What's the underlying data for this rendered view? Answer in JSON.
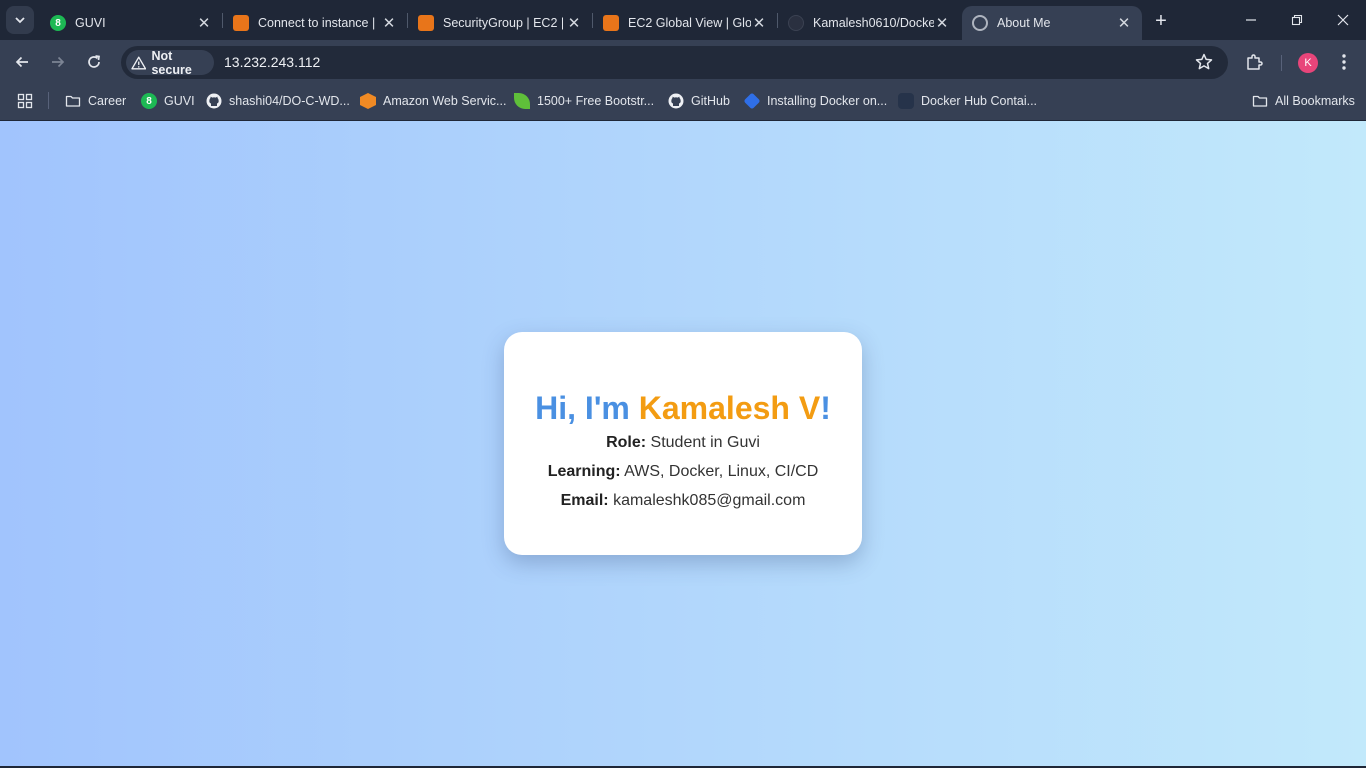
{
  "tabs": [
    {
      "title": "GUVI",
      "favicon": "guvi-icon"
    },
    {
      "title": "Connect to instance |",
      "favicon": "aws-ec2-icon"
    },
    {
      "title": "SecurityGroup | EC2 |",
      "favicon": "aws-ec2-icon"
    },
    {
      "title": "EC2 Global View | Glo",
      "favicon": "aws-ec2-icon"
    },
    {
      "title": "Kamalesh0610/Docke",
      "favicon": "github-icon"
    },
    {
      "title": "About Me",
      "favicon": "globe-icon",
      "active": true
    }
  ],
  "toolbar": {
    "security_label": "Not secure",
    "url": "13.232.243.112",
    "profile_initial": "K"
  },
  "bookmarks": [
    {
      "label": "Career",
      "icon": "folder-icon"
    },
    {
      "label": "GUVI",
      "icon": "guvi-icon"
    },
    {
      "label": "shashi04/DO-C-WD...",
      "icon": "github-icon"
    },
    {
      "label": "Amazon Web Servic...",
      "icon": "aws-cube-icon"
    },
    {
      "label": "1500+ Free Bootstr...",
      "icon": "leaf-icon"
    },
    {
      "label": "GitHub",
      "icon": "github-icon"
    },
    {
      "label": "Installing Docker on...",
      "icon": "docs-icon"
    },
    {
      "label": "Docker Hub Contai...",
      "icon": "docker-icon"
    }
  ],
  "all_bookmarks_label": "All Bookmarks",
  "page": {
    "greeting_prefix": "Hi, I'm ",
    "name": "Kamalesh V",
    "greeting_suffix": "!",
    "role_label": "Role:",
    "role_value": " Student in Guvi",
    "learning_label": "Learning:",
    "learning_value": " AWS, Docker, Linux, CI/CD",
    "email_label": "Email:",
    "email_value": " kamaleshk085@gmail.com"
  },
  "colors": {
    "gradient_start": "#a1c4fd",
    "gradient_end": "#c2e9fb",
    "greeting": "#4a90e2",
    "name_accent": "#f39c12"
  }
}
